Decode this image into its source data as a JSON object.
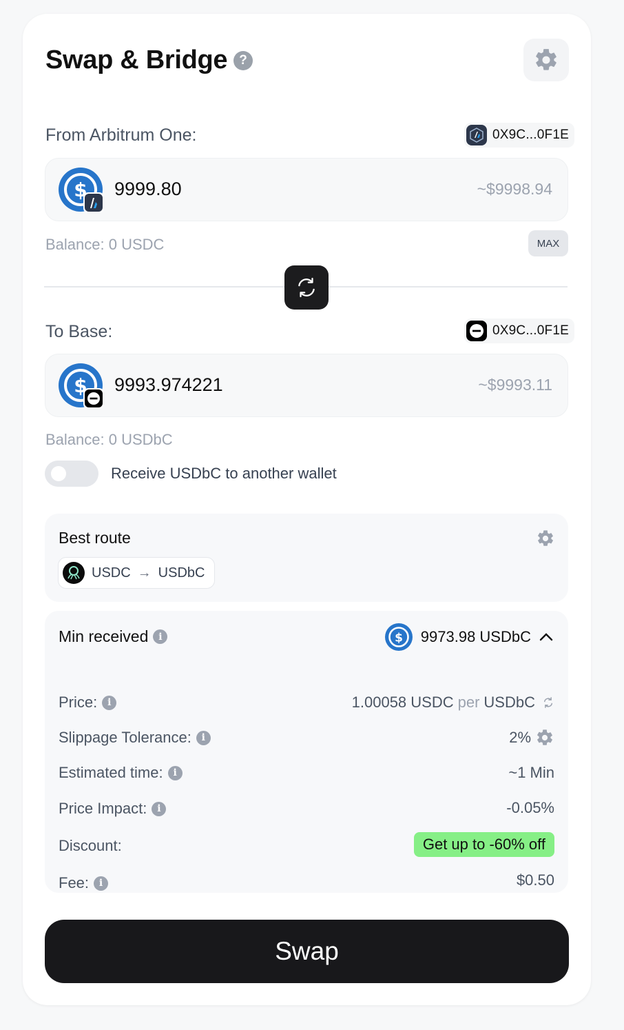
{
  "header": {
    "title": "Swap & Bridge",
    "help_icon_glyph": "?"
  },
  "from": {
    "label": "From Arbitrum One:",
    "wallet": "0X9C...0F1E",
    "amount": "9999.80",
    "usd_value": "~$9998.94",
    "balance": "Balance: 0 USDC",
    "max_label": "MAX"
  },
  "to": {
    "label": "To Base:",
    "wallet": "0X9C...0F1E",
    "amount": "9993.974221",
    "usd_value": "~$9993.11",
    "balance": "Balance: 0 USDbC"
  },
  "recipient_toggle": {
    "label": "Receive USDbC to another wallet",
    "on": false
  },
  "route": {
    "title": "Best route",
    "from_token": "USDC",
    "arrow": "→",
    "to_token": "USDbC"
  },
  "details": {
    "min_received_label": "Min received",
    "min_received_value": "9973.98 USDbC",
    "price_label": "Price:",
    "price_amount": "1.00058 USDC",
    "price_per": "per",
    "price_quote": "USDbC",
    "slippage_label": "Slippage Tolerance:",
    "slippage_value": "2%",
    "time_label": "Estimated time:",
    "time_value": "~1 Min",
    "impact_label": "Price Impact:",
    "impact_value": "-0.05%",
    "discount_label": "Discount:",
    "discount_value": "Get up to -60% off",
    "fee_label": "Fee:",
    "fee_value": "$0.50",
    "info_glyph": "i"
  },
  "swap_button": {
    "label": "Swap"
  },
  "colors": {
    "usdc_blue": "#2775ca",
    "discount_green": "#86ef86",
    "primary_dark": "#18181b"
  },
  "icons": [
    "help-icon",
    "gear-icon",
    "arbitrum-icon",
    "base-icon",
    "usdc-icon",
    "swap-arrows-icon",
    "aggregator-icon",
    "info-icon",
    "chevron-up-icon",
    "refresh-icon"
  ]
}
